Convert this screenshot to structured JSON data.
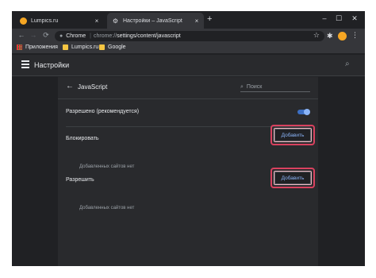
{
  "tabs": [
    {
      "title": "Lumpics.ru",
      "close": "×"
    },
    {
      "title": "Настройки – JavaScript",
      "close": "×",
      "icon": "⚙"
    }
  ],
  "new_tab": "+",
  "window_controls": {
    "minimize": "–",
    "maximize": "☐",
    "close": "✕"
  },
  "toolbar": {
    "back": "←",
    "forward": "→",
    "reload": "⟳",
    "site_label": "Chrome",
    "separator": "|",
    "url_scheme": "chrome://",
    "url_path": "settings/content/javascript",
    "star": "☆",
    "extensions": "✱",
    "menu": "⋮"
  },
  "bookmarks": [
    {
      "label": "Приложения",
      "icon": "apps-icon"
    },
    {
      "label": "Lumpics.ru",
      "icon": "folder-icon"
    },
    {
      "label": "Google",
      "icon": "folder-icon"
    }
  ],
  "settings": {
    "title": "Настройки",
    "search_icon": "⌕"
  },
  "page": {
    "back": "←",
    "title": "JavaScript",
    "search_placeholder": "Поиск",
    "search_icon": "⌕",
    "allowed_label": "Разрешено (рекомендуется)",
    "allowed_toggle_on": true,
    "block": {
      "label": "Блокировать",
      "button": "Добавить",
      "empty": "Добавленных сайтов нет"
    },
    "allow": {
      "label": "Разрешить",
      "button": "Добавить",
      "empty": "Добавленных сайтов нет"
    }
  },
  "colors": {
    "accent": "#8ab4f8",
    "highlight": "#d9425f",
    "avatar": "#f6a623"
  }
}
